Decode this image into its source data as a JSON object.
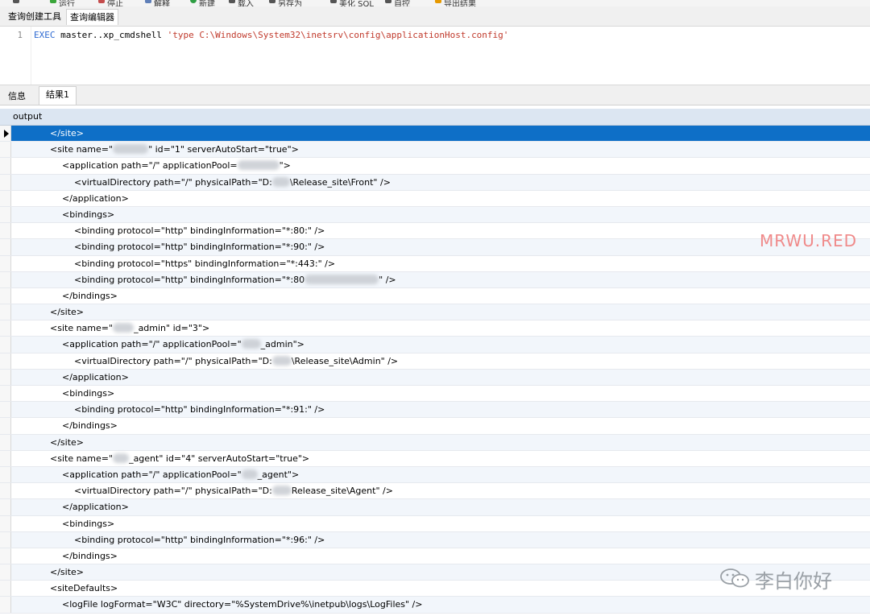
{
  "toolbar": {
    "items": [
      {
        "label": "运行",
        "color": "#3aa63a"
      },
      {
        "label": "停止",
        "color": "#c44c4c"
      },
      {
        "label": "解释",
        "color": "#5f7fb8"
      },
      {
        "label": "新建",
        "color": "#2f9e44"
      },
      {
        "label": "载入",
        "color": "#555555"
      },
      {
        "label": "另存为",
        "color": "#555555"
      },
      {
        "label": "美化 SQL",
        "color": "#555555"
      },
      {
        "label": "自控",
        "color": "#555555"
      },
      {
        "label": "导出结果",
        "color": "#e69900"
      }
    ]
  },
  "query_tabs": {
    "builder_label": "查询创建工具",
    "editor_label": "查询编辑器"
  },
  "editor": {
    "line_number": "1",
    "keyword": "EXEC",
    "code_mid": " master..xp_cmdshell ",
    "string_literal": "'type C:\\Windows\\System32\\inetsrv\\config\\applicationHost.config'"
  },
  "result_tabs": {
    "info_label": "信息",
    "result_label": "结果1"
  },
  "grid": {
    "column_header": "output",
    "rows": [
      {
        "indent": 1,
        "pre": "</site>",
        "post": ""
      },
      {
        "indent": 1,
        "pre": "<site name=\"",
        "post": "\" id=\"1\" serverAutoStart=\"true\">"
      },
      {
        "indent": 2,
        "pre": "<application path=\"/\" applicationPool=",
        "post": "\">"
      },
      {
        "indent": 3,
        "pre": "<virtualDirectory path=\"/\" physicalPath=\"D:",
        "post": "\\Release_site\\Front\" />"
      },
      {
        "indent": 2,
        "pre": "</application>",
        "post": ""
      },
      {
        "indent": 2,
        "pre": "<bindings>",
        "post": ""
      },
      {
        "indent": 3,
        "pre": "<binding protocol=\"http\" bindingInformation=\"*:80:\" />",
        "post": ""
      },
      {
        "indent": 3,
        "pre": "<binding protocol=\"http\" bindingInformation=\"*:90:\" />",
        "post": ""
      },
      {
        "indent": 3,
        "pre": "<binding protocol=\"https\" bindingInformation=\"*:443:\" />",
        "post": ""
      },
      {
        "indent": 3,
        "pre": "<binding protocol=\"http\" bindingInformation=\"*:80",
        "post": "\" />"
      },
      {
        "indent": 2,
        "pre": "</bindings>",
        "post": ""
      },
      {
        "indent": 1,
        "pre": "</site>",
        "post": ""
      },
      {
        "indent": 1,
        "pre": "<site name=\"",
        "post": "_admin\" id=\"3\">"
      },
      {
        "indent": 2,
        "pre": "<application path=\"/\" applicationPool=\"",
        "post": "_admin\">"
      },
      {
        "indent": 3,
        "pre": "<virtualDirectory path=\"/\" physicalPath=\"D:",
        "post": "\\Release_site\\Admin\" />"
      },
      {
        "indent": 2,
        "pre": "</application>",
        "post": ""
      },
      {
        "indent": 2,
        "pre": "<bindings>",
        "post": ""
      },
      {
        "indent": 3,
        "pre": "<binding protocol=\"http\" bindingInformation=\"*:91:\" />",
        "post": ""
      },
      {
        "indent": 2,
        "pre": "</bindings>",
        "post": ""
      },
      {
        "indent": 1,
        "pre": "</site>",
        "post": ""
      },
      {
        "indent": 1,
        "pre": "<site name=\"",
        "post": "_agent\" id=\"4\" serverAutoStart=\"true\">"
      },
      {
        "indent": 2,
        "pre": "<application path=\"/\" applicationPool=\"",
        "post": "_agent\">"
      },
      {
        "indent": 3,
        "pre": "<virtualDirectory path=\"/\" physicalPath=\"D:",
        "post": "Release_site\\Agent\" />"
      },
      {
        "indent": 2,
        "pre": "</application>",
        "post": ""
      },
      {
        "indent": 2,
        "pre": "<bindings>",
        "post": ""
      },
      {
        "indent": 3,
        "pre": "<binding protocol=\"http\" bindingInformation=\"*:96:\" />",
        "post": ""
      },
      {
        "indent": 2,
        "pre": "</bindings>",
        "post": ""
      },
      {
        "indent": 1,
        "pre": "</site>",
        "post": ""
      },
      {
        "indent": 1,
        "pre": "<siteDefaults>",
        "post": ""
      },
      {
        "indent": 2,
        "pre": "<logFile logFormat=\"W3C\" directory=\"%SystemDrive%\\inetpub\\logs\\LogFiles\" />",
        "post": ""
      }
    ]
  },
  "watermark": {
    "text": "MRWU.RED",
    "color": "#f08a8a"
  },
  "wechat": {
    "icon": "wechat-icon",
    "account": "李白你好"
  }
}
